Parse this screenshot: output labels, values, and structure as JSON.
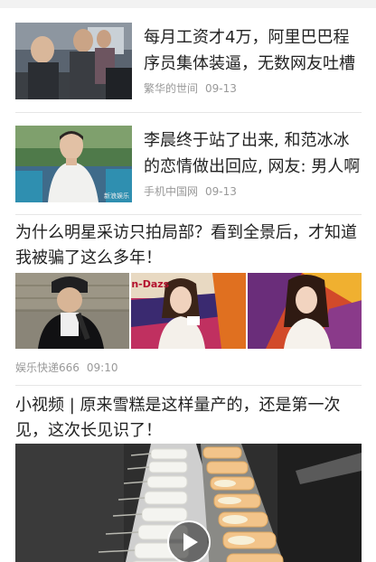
{
  "feed": {
    "items": [
      {
        "title": "每月工资才4万，阿里巴巴程序员集体装逼，无数网友吐槽",
        "source": "繁华的世间",
        "date": "09-13"
      },
      {
        "title": "李晨终于站了出来, 和范冰冰的恋情做出回应, 网友: 男人啊",
        "source": "手机中国网",
        "date": "09-13",
        "watermark": "新浪娱乐"
      },
      {
        "title": "为什么明星采访只拍局部？看到全景后，才知道我被骗了这么多年！",
        "source": "娱乐快递666",
        "date": "09:10",
        "image_text": "n-Dazs"
      },
      {
        "title": "小视频 | 原来雪糕是这样量产的，还是第一次见，这次长见识了！"
      }
    ]
  },
  "colors": {
    "text": "#222222",
    "meta": "#999999",
    "separator": "#e6e6e6"
  }
}
